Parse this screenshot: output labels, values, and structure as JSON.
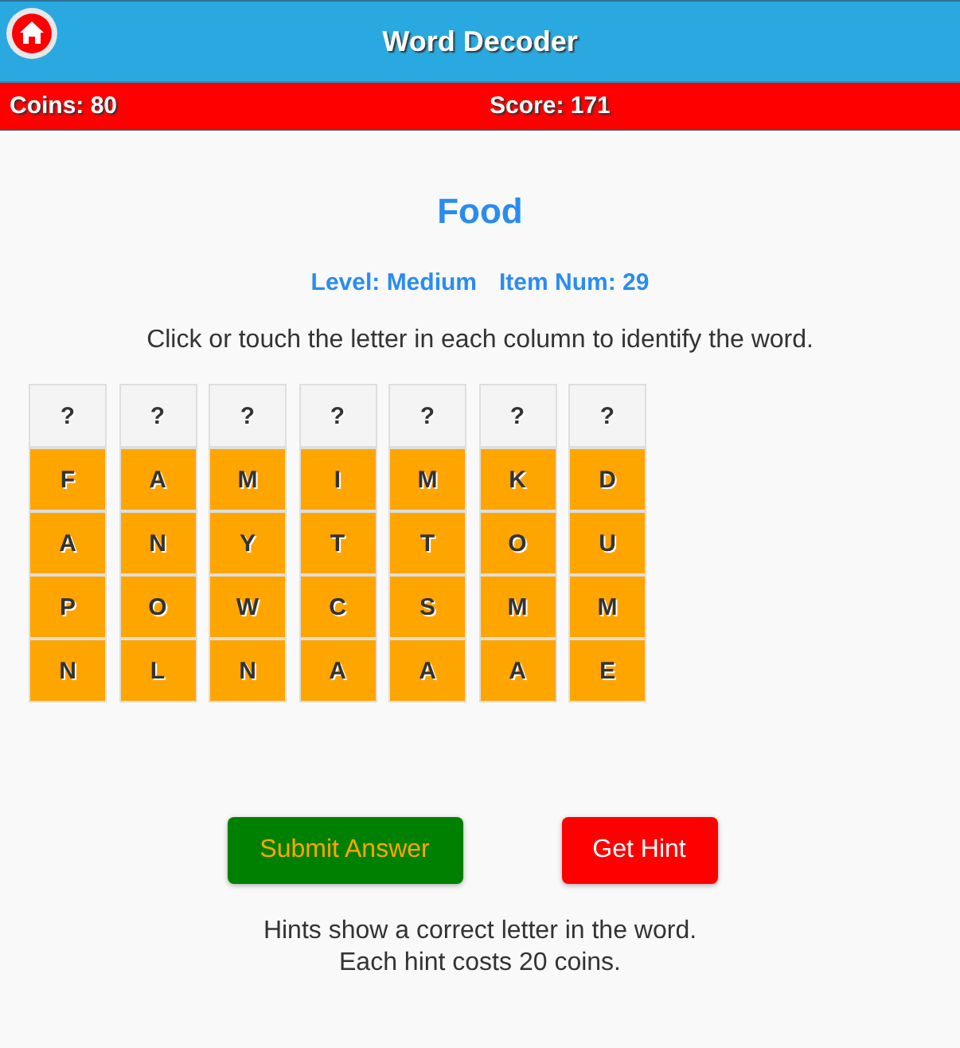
{
  "header": {
    "title": "Word Decoder"
  },
  "stats": {
    "coins": "Coins: 80",
    "score": "Score: 171"
  },
  "puzzle": {
    "category": "Food",
    "level": "Level: Medium",
    "item_num": "Item Num: 29",
    "instructions": "Click or touch the letter in each column to identify the word."
  },
  "columns": [
    {
      "answer": "?",
      "letters": [
        "F",
        "A",
        "P",
        "N"
      ]
    },
    {
      "answer": "?",
      "letters": [
        "A",
        "N",
        "O",
        "L"
      ]
    },
    {
      "answer": "?",
      "letters": [
        "M",
        "Y",
        "W",
        "N"
      ]
    },
    {
      "answer": "?",
      "letters": [
        "I",
        "T",
        "C",
        "A"
      ]
    },
    {
      "answer": "?",
      "letters": [
        "M",
        "T",
        "S",
        "A"
      ]
    },
    {
      "answer": "?",
      "letters": [
        "K",
        "O",
        "M",
        "A"
      ]
    },
    {
      "answer": "?",
      "letters": [
        "D",
        "U",
        "M",
        "E"
      ]
    }
  ],
  "buttons": [
    {
      "label": "Submit Answer",
      "kind": "submit"
    },
    {
      "label": "Get Hint",
      "kind": "hint"
    }
  ],
  "notes": [
    "Hints show a correct letter in the word.",
    "Each hint costs 20 coins."
  ]
}
